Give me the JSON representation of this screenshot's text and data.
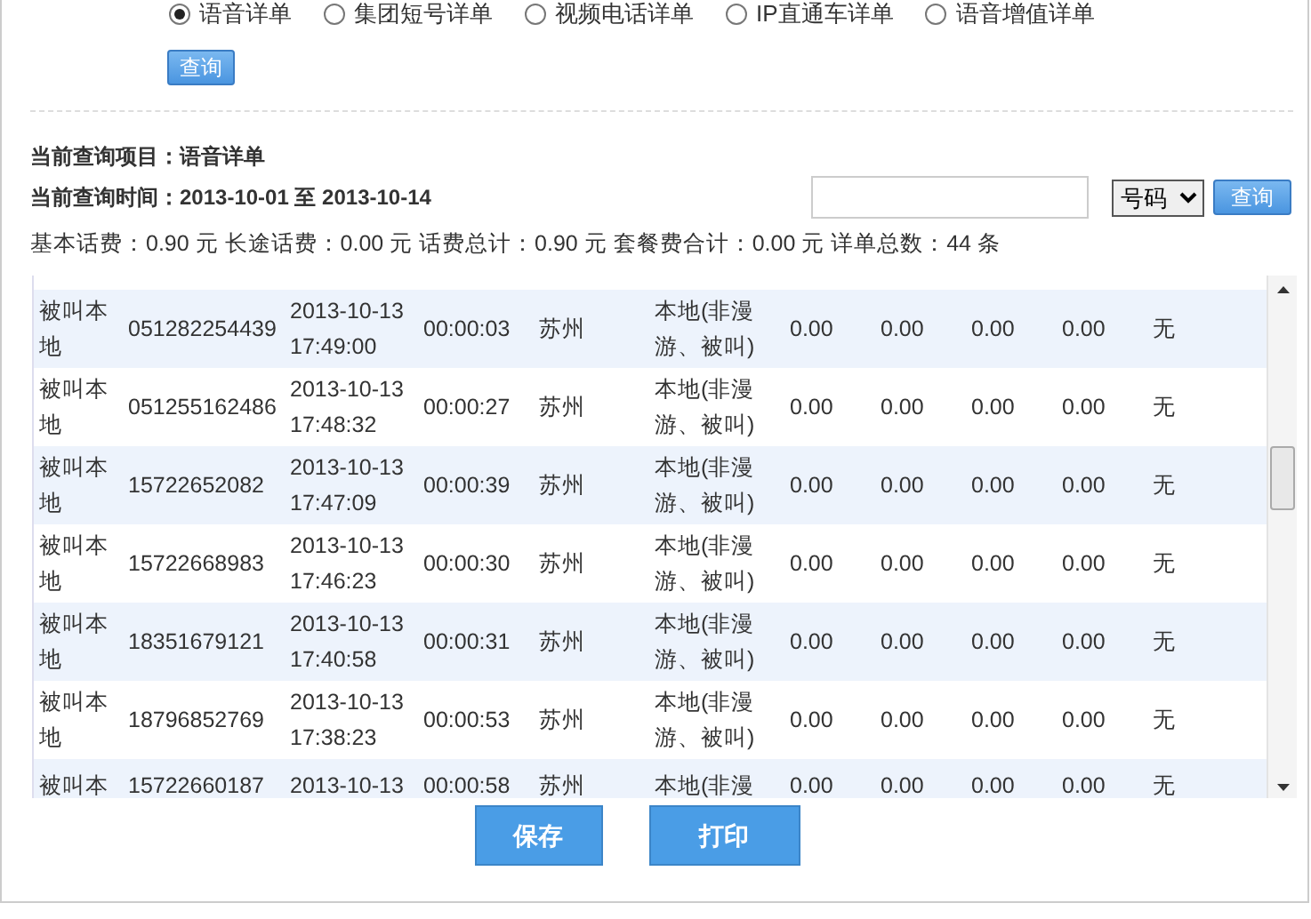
{
  "query_types": [
    {
      "label": "语音详单",
      "selected": true
    },
    {
      "label": "集团短号详单",
      "selected": false
    },
    {
      "label": "视频电话详单",
      "selected": false
    },
    {
      "label": "IP直通车详单",
      "selected": false
    },
    {
      "label": "语音增值详单",
      "selected": false
    }
  ],
  "query_button": "查询",
  "current_item": {
    "label": "当前查询项目：",
    "value": "语音详单"
  },
  "current_time": {
    "label": "当前查询时间：",
    "value": "2013-10-01 至  2013-10-14"
  },
  "search": {
    "select_value": "号码",
    "button": "查询"
  },
  "summary": "基本话费：0.90 元 长途话费：0.00 元 话费总计：0.90 元 套餐费合计：0.00 元 详单总数：44 条",
  "rows": [
    {
      "cells": [
        "被叫本地",
        "051282254439",
        "2013-10-13 17:49:00",
        "00:00:03",
        "苏州",
        "本地(非漫游、被叫)",
        "0.00",
        "0.00",
        "0.00",
        "0.00",
        "无"
      ]
    },
    {
      "cells": [
        "被叫本地",
        "051255162486",
        "2013-10-13 17:48:32",
        "00:00:27",
        "苏州",
        "本地(非漫游、被叫)",
        "0.00",
        "0.00",
        "0.00",
        "0.00",
        "无"
      ]
    },
    {
      "cells": [
        "被叫本地",
        "15722652082",
        "2013-10-13 17:47:09",
        "00:00:39",
        "苏州",
        "本地(非漫游、被叫)",
        "0.00",
        "0.00",
        "0.00",
        "0.00",
        "无"
      ]
    },
    {
      "cells": [
        "被叫本地",
        "15722668983",
        "2013-10-13 17:46:23",
        "00:00:30",
        "苏州",
        "本地(非漫游、被叫)",
        "0.00",
        "0.00",
        "0.00",
        "0.00",
        "无"
      ]
    },
    {
      "cells": [
        "被叫本地",
        "18351679121",
        "2013-10-13 17:40:58",
        "00:00:31",
        "苏州",
        "本地(非漫游、被叫)",
        "0.00",
        "0.00",
        "0.00",
        "0.00",
        "无"
      ]
    },
    {
      "cells": [
        "被叫本地",
        "18796852769",
        "2013-10-13 17:38:23",
        "00:00:53",
        "苏州",
        "本地(非漫游、被叫)",
        "0.00",
        "0.00",
        "0.00",
        "0.00",
        "无"
      ]
    },
    {
      "cells": [
        "被叫本",
        "15722660187",
        "2013-10-13",
        "00:00:58",
        "苏州",
        "本地(非漫",
        "0.00",
        "0.00",
        "0.00",
        "0.00",
        "无"
      ]
    }
  ],
  "actions": [
    "保存",
    "打印"
  ]
}
